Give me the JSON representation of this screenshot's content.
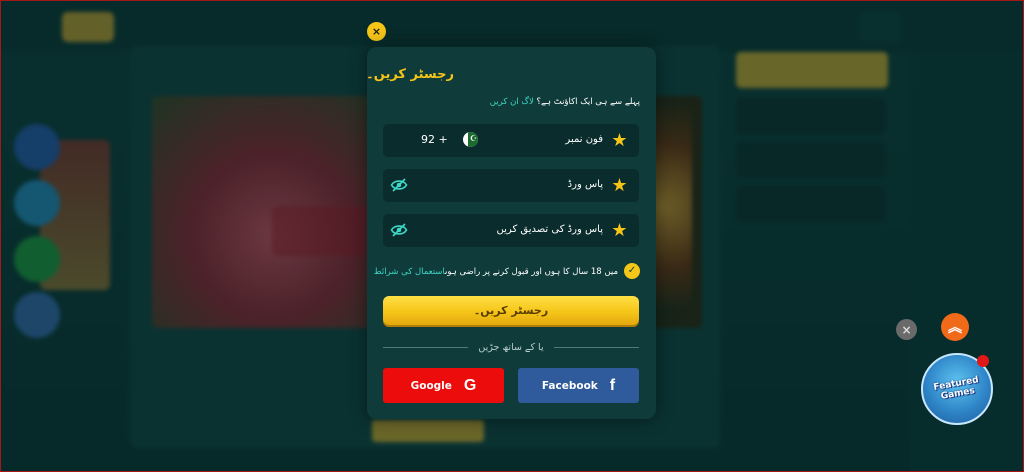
{
  "modal": {
    "close_icon": "×",
    "title": "رجسٹر کریں۔",
    "login_prompt": "پہلے سے ہی ایک اکاؤنٹ ہے؟",
    "login_link": "لاگ ان کریں",
    "fields": [
      {
        "label": "فون نمبر",
        "prefix": "92 +",
        "type": "phone"
      },
      {
        "label": "پاس ورڈ",
        "type": "password"
      },
      {
        "label": "پاس ورڈ کی تصدیق کریں",
        "type": "password"
      }
    ],
    "terms_text": "میں 18 سال کا ہوں اور قبول کرنے پر راضی ہوں",
    "terms_link": "استعمال کی شرائط",
    "register_button": "رجسٹر کریں۔",
    "divider_text": "یا کے ساتھ جڑیں",
    "google_label": "Google",
    "facebook_label": "Facebook"
  },
  "floating": {
    "games_label": "Featured Games"
  },
  "colors": {
    "accent": "#f5c518",
    "link": "#3fd7c6",
    "google": "#ec0c0c",
    "facebook": "#2f5a9b",
    "modal_bg": "#0f3c3b"
  },
  "icons": {
    "star": "star-icon",
    "eye_off": "eye-off-icon",
    "flag": "pakistan-flag-icon",
    "check": "check-icon",
    "google": "google-icon",
    "facebook": "facebook-icon",
    "close": "close-icon",
    "scroll_up": "chevron-double-up-icon"
  }
}
